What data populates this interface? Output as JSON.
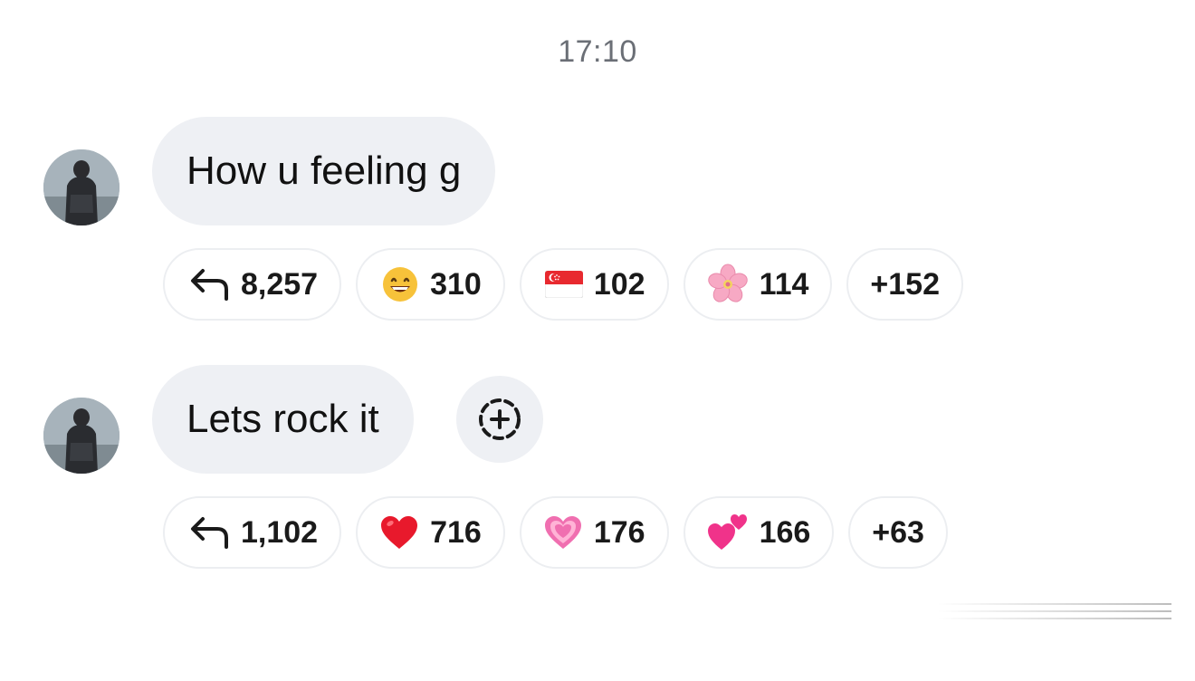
{
  "timestamp": "17:10",
  "messages": [
    {
      "text": "How u feeling g",
      "reactions": [
        {
          "icon": "reply-arrow-icon",
          "count": "8,257"
        },
        {
          "icon": "grinning-face-emoji",
          "count": "310"
        },
        {
          "icon": "singapore-flag-emoji",
          "count": "102"
        },
        {
          "icon": "cherry-blossom-emoji",
          "count": "114"
        },
        {
          "icon": "more-reactions",
          "count": "+152"
        }
      ]
    },
    {
      "text": "Lets rock it",
      "reactions": [
        {
          "icon": "reply-arrow-icon",
          "count": "1,102"
        },
        {
          "icon": "red-heart-emoji",
          "count": "716"
        },
        {
          "icon": "growing-heart-emoji",
          "count": "176"
        },
        {
          "icon": "two-hearts-emoji",
          "count": "166"
        },
        {
          "icon": "more-reactions",
          "count": "+63"
        }
      ]
    }
  ],
  "colors": {
    "bubble": "#eef0f4",
    "timestamp": "#6b6f76",
    "chip_border": "#eceef1"
  }
}
